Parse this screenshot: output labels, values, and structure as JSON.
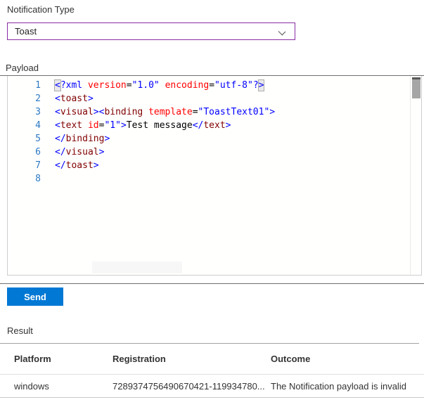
{
  "colors": {
    "accent": "#8A2DA5",
    "primary": "#0078D4",
    "tk-blue": "#0000FF",
    "tk-tag": "#800000",
    "tk-attr": "#FF0000",
    "line-num": "#2B79C2",
    "text": "#333333"
  },
  "notification_type": {
    "label": "Notification Type",
    "value": "Toast"
  },
  "payload": {
    "label": "Payload",
    "lines": [
      {
        "num": "1",
        "tokens": [
          {
            "c": "d",
            "t": "<",
            "box": true
          },
          {
            "c": "pi",
            "t": "?xml"
          },
          {
            "c": "txt",
            "t": " "
          },
          {
            "c": "attr",
            "t": "version"
          },
          {
            "c": "eq",
            "t": "="
          },
          {
            "c": "val",
            "t": "\"1.0\""
          },
          {
            "c": "txt",
            "t": " "
          },
          {
            "c": "attr",
            "t": "encoding"
          },
          {
            "c": "eq",
            "t": "="
          },
          {
            "c": "val",
            "t": "\"utf-8\""
          },
          {
            "c": "d",
            "t": "?"
          },
          {
            "c": "d",
            "t": ">",
            "box": true
          }
        ]
      },
      {
        "num": "2",
        "tokens": [
          {
            "c": "d",
            "t": "<"
          },
          {
            "c": "tag",
            "t": "toast"
          },
          {
            "c": "d",
            "t": ">"
          }
        ]
      },
      {
        "num": "3",
        "tokens": [
          {
            "c": "d",
            "t": "<"
          },
          {
            "c": "tag",
            "t": "visual"
          },
          {
            "c": "d",
            "t": "><"
          },
          {
            "c": "tag",
            "t": "binding"
          },
          {
            "c": "txt",
            "t": " "
          },
          {
            "c": "attr",
            "t": "template"
          },
          {
            "c": "eq",
            "t": "="
          },
          {
            "c": "val",
            "t": "\"ToastText01\""
          },
          {
            "c": "d",
            "t": ">"
          }
        ]
      },
      {
        "num": "4",
        "tokens": [
          {
            "c": "d",
            "t": "<"
          },
          {
            "c": "tag",
            "t": "text"
          },
          {
            "c": "txt",
            "t": " "
          },
          {
            "c": "attr",
            "t": "id"
          },
          {
            "c": "eq",
            "t": "="
          },
          {
            "c": "val",
            "t": "\"1\""
          },
          {
            "c": "d",
            "t": ">"
          },
          {
            "c": "txt",
            "t": "Test message"
          },
          {
            "c": "d",
            "t": "</"
          },
          {
            "c": "tag",
            "t": "text"
          },
          {
            "c": "d",
            "t": ">"
          }
        ]
      },
      {
        "num": "5",
        "tokens": [
          {
            "c": "d",
            "t": "</"
          },
          {
            "c": "tag",
            "t": "binding"
          },
          {
            "c": "d",
            "t": ">"
          }
        ]
      },
      {
        "num": "6",
        "tokens": [
          {
            "c": "d",
            "t": "</"
          },
          {
            "c": "tag",
            "t": "visual"
          },
          {
            "c": "d",
            "t": ">"
          }
        ]
      },
      {
        "num": "7",
        "tokens": [
          {
            "c": "d",
            "t": "</"
          },
          {
            "c": "tag",
            "t": "toast"
          },
          {
            "c": "d",
            "t": ">"
          }
        ]
      },
      {
        "num": "8",
        "tokens": []
      }
    ]
  },
  "send_button": {
    "label": "Send"
  },
  "result": {
    "label": "Result",
    "columns": [
      "Platform",
      "Registration",
      "Outcome"
    ],
    "rows": [
      [
        "windows",
        "7289374756490670421-119934780...",
        "The Notification payload is invalid"
      ]
    ]
  }
}
